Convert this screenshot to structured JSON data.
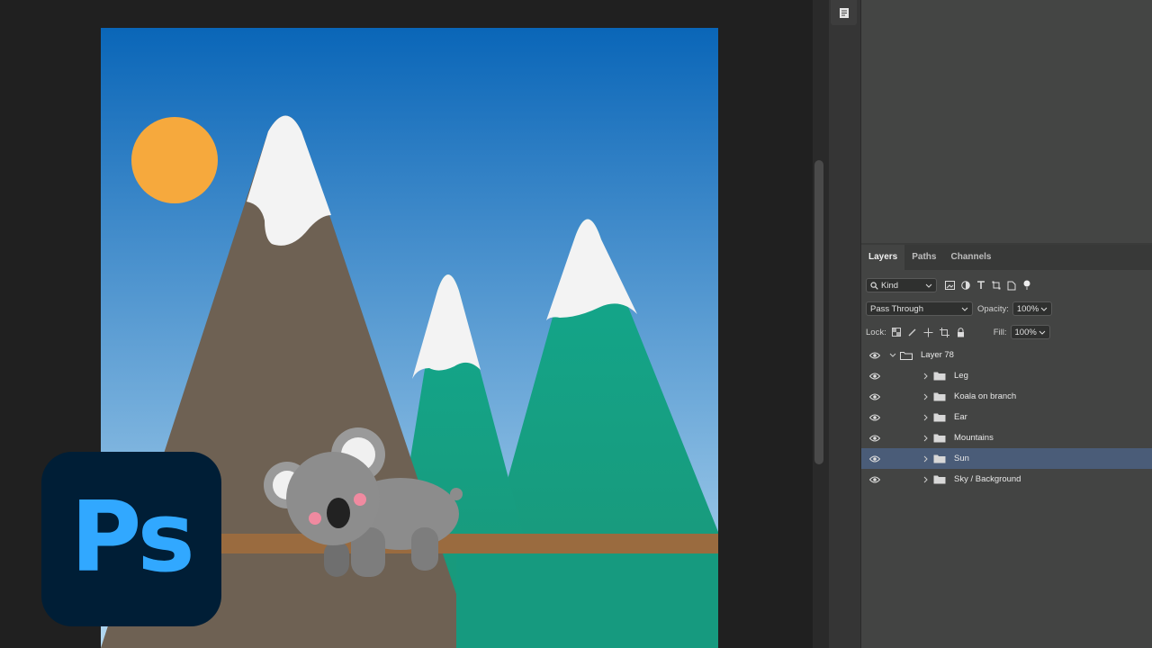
{
  "layers_panel": {
    "tabs": [
      {
        "label": "Layers",
        "active": true
      },
      {
        "label": "Paths",
        "active": false
      },
      {
        "label": "Channels",
        "active": false
      }
    ],
    "filter_kind": "Kind",
    "blend_mode": "Pass Through",
    "opacity_label": "Opacity:",
    "opacity_value": "100%",
    "lock_label": "Lock:",
    "fill_label": "Fill:",
    "fill_value": "100%",
    "group_name": "Layer 78",
    "layers": [
      {
        "name": "Leg",
        "selected": false
      },
      {
        "name": "Koala on branch",
        "selected": false
      },
      {
        "name": "Ear",
        "selected": false
      },
      {
        "name": "Mountains",
        "selected": false
      },
      {
        "name": "Sun",
        "selected": true
      },
      {
        "name": "Sky / Background",
        "selected": false
      }
    ]
  },
  "logo": {
    "text": "Ps"
  },
  "colors": {
    "sky_top": "#0a6bbd",
    "sky_bottom": "#a9d3ef",
    "sun": "#f6a93d",
    "mountain_brown": "#6e6153",
    "mountain_teal": "#14a28a",
    "snow": "#f2f2f2",
    "branch": "#9a6b3f",
    "koala": "#8a8a8a",
    "ps_bg": "#001e36",
    "ps_text": "#31a8ff",
    "selection": "#4a5c78"
  }
}
